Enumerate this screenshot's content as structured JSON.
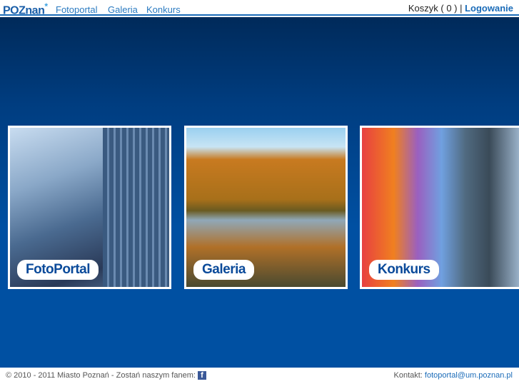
{
  "header": {
    "logo": "POZnan",
    "logo_mark": "*",
    "nav": [
      "Fotoportal",
      "Galeria",
      "Konkurs"
    ],
    "cart": "Koszyk ( 0 ) |",
    "login": "Logowanie"
  },
  "tiles": [
    {
      "label": "FotoPortal"
    },
    {
      "label": "Galeria"
    },
    {
      "label": "Konkurs"
    }
  ],
  "footer": {
    "copyright": "© 2010 - 2011 Miasto Poznań - Zostań naszym fanem:",
    "fb": "f",
    "contact_label": "Kontakt:",
    "email": "fotoportal@um.poznan.pl"
  }
}
